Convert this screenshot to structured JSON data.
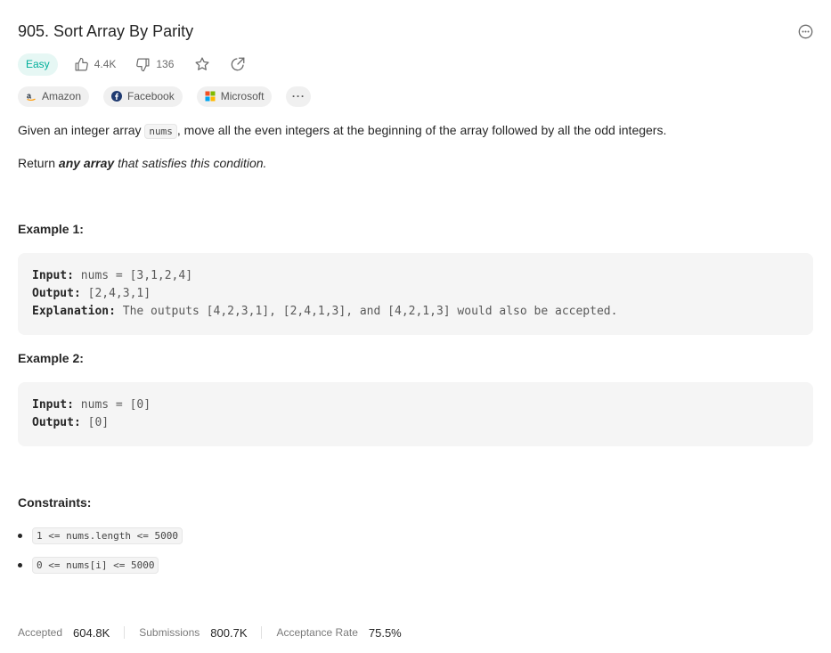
{
  "problem": {
    "title": "905. Sort Array By Parity",
    "difficulty": "Easy",
    "likes": "4.4K",
    "dislikes": "136"
  },
  "tags": [
    {
      "label": "Amazon",
      "icon": "amazon-icon"
    },
    {
      "label": "Facebook",
      "icon": "facebook-icon"
    },
    {
      "label": "Microsoft",
      "icon": "microsoft-icon"
    }
  ],
  "tags_more": "···",
  "description": {
    "p1_before": "Given an integer array ",
    "p1_code": "nums",
    "p1_after": ", move all the even integers at the beginning of the array followed by all the odd integers.",
    "p2_before": "Return ",
    "p2_bold": "any array",
    "p2_after": " that satisfies this condition."
  },
  "examples": [
    {
      "heading": "Example 1:",
      "input_label": "Input:",
      "input": "nums = [3,1,2,4]",
      "output_label": "Output:",
      "output": "[2,4,3,1]",
      "explanation_label": "Explanation:",
      "explanation": "The outputs [4,2,3,1], [2,4,1,3], and [4,2,1,3] would also be accepted."
    },
    {
      "heading": "Example 2:",
      "input_label": "Input:",
      "input": "nums = [0]",
      "output_label": "Output:",
      "output": "[0]"
    }
  ],
  "constraints": {
    "heading": "Constraints:",
    "items": [
      "1 <= nums.length <= 5000",
      "0 <= nums[i] <= 5000"
    ]
  },
  "stats": {
    "accepted_label": "Accepted",
    "accepted": "604.8K",
    "submissions_label": "Submissions",
    "submissions": "800.7K",
    "rate_label": "Acceptance Rate",
    "rate": "75.5%"
  },
  "colors": {
    "easy": "#00af9b",
    "easy_bg": "#e6f7f4",
    "amazon": "#ff9900",
    "facebook": "#1877f2"
  }
}
